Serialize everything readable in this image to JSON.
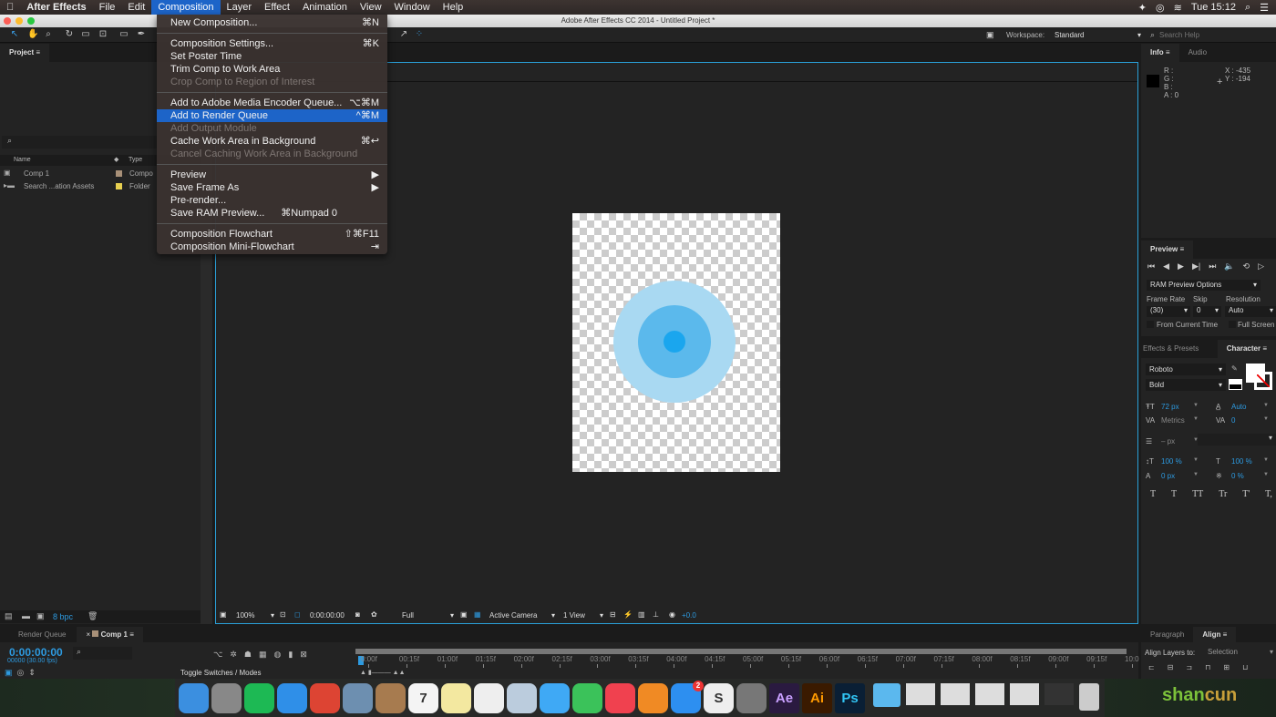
{
  "menubar": {
    "app": "After Effects",
    "items": [
      "File",
      "Edit",
      "Composition",
      "Layer",
      "Effect",
      "Animation",
      "View",
      "Window",
      "Help"
    ],
    "active": "Composition",
    "clock": "Tue 15:12"
  },
  "window_title": "Adobe After Effects CC 2014 - Untitled Project *",
  "toolbar": {
    "workspace_label": "Workspace:",
    "workspace_value": "Standard",
    "search_placeholder": "Search Help"
  },
  "composition_menu": [
    [
      {
        "label": "New Composition...",
        "shortcut": "⌘N"
      }
    ],
    [
      {
        "label": "Composition Settings...",
        "shortcut": "⌘K"
      },
      {
        "label": "Set Poster Time",
        "shortcut": ""
      },
      {
        "label": "Trim Comp to Work Area",
        "shortcut": ""
      },
      {
        "label": "Crop Comp to Region of Interest",
        "shortcut": "",
        "disabled": true
      }
    ],
    [
      {
        "label": "Add to Adobe Media Encoder Queue...",
        "shortcut": "⌥⌘M"
      },
      {
        "label": "Add to Render Queue",
        "shortcut": "^⌘M",
        "highlighted": true
      },
      {
        "label": "Add Output Module",
        "shortcut": "",
        "disabled": true
      },
      {
        "label": "Cache Work Area in Background",
        "shortcut": "⌘↩"
      },
      {
        "label": "Cancel Caching Work Area in Background",
        "shortcut": "",
        "disabled": true
      }
    ],
    [
      {
        "label": "Preview",
        "shortcut": "▶"
      },
      {
        "label": "Save Frame As",
        "shortcut": "▶"
      },
      {
        "label": "Pre-render...",
        "shortcut": ""
      },
      {
        "label": "Save RAM Preview...",
        "shortcut": "⌘Numpad 0"
      }
    ],
    [
      {
        "label": "Composition Flowchart",
        "shortcut": "⇧⌘F11"
      },
      {
        "label": "Composition Mini-Flowchart",
        "shortcut": "⇥"
      }
    ]
  ],
  "project": {
    "tab": "Project",
    "columns": [
      "Name",
      "Type"
    ],
    "items": [
      {
        "name": "Comp 1",
        "type": "Compo",
        "color": "#a89078"
      },
      {
        "name": "Search ...ation Assets",
        "type": "Folder",
        "color": "#e8d050"
      }
    ],
    "bpc": "8 bpc"
  },
  "viewer": {
    "zoom": "100%",
    "timecode": "0:00:00:00",
    "resolution": "Full",
    "camera": "Active Camera",
    "views": "1 View",
    "exposure": "+0.0",
    "circle_colors": [
      "#a9d9f2",
      "#5bb9ec",
      "#1aa6ee"
    ]
  },
  "info": {
    "tabs": [
      "Info",
      "Audio"
    ],
    "r": "R :",
    "g": "G :",
    "b": "B :",
    "a": "A : 0",
    "x": "X : -435",
    "y": "Y : -194"
  },
  "preview": {
    "tab": "Preview",
    "options": "RAM Preview Options",
    "frame_rate_label": "Frame Rate",
    "skip_label": "Skip",
    "resolution_label": "Resolution",
    "frame_rate": "(30)",
    "skip": "0",
    "resolution": "Auto",
    "from_current": "From Current Time",
    "full_screen": "Full Screen"
  },
  "character": {
    "tabs": [
      "Effects & Presets",
      "Character"
    ],
    "font": "Roboto",
    "style": "Bold",
    "size": "72 px",
    "leading": "Auto",
    "kerning": "Metrics",
    "tracking": "0",
    "stroke": "– px",
    "vscale": "100 %",
    "hscale": "100 %",
    "baseline": "0 px",
    "tsume": "0 %",
    "styles": [
      "T",
      "T",
      "TT",
      "Tr",
      "T'",
      "T,"
    ]
  },
  "timeline": {
    "tabs": [
      "Render Queue",
      "Comp 1"
    ],
    "timecode": "0:00:00:00",
    "frames": "00000 (30.00 fps)",
    "toggle": "Toggle Switches / Modes",
    "ruler": [
      "0:00f",
      "00:15f",
      "01:00f",
      "01:15f",
      "02:00f",
      "02:15f",
      "03:00f",
      "03:15f",
      "04:00f",
      "04:15f",
      "05:00f",
      "05:15f",
      "06:00f",
      "06:15f",
      "07:00f",
      "07:15f",
      "08:00f",
      "08:15f",
      "09:00f",
      "09:15f",
      "10:0"
    ]
  },
  "align": {
    "tabs": [
      "Paragraph",
      "Align"
    ],
    "label": "Align Layers to:",
    "value": "Selection"
  },
  "dock": [
    {
      "name": "finder",
      "c": "#3b8fe0",
      "t": ""
    },
    {
      "name": "launchpad",
      "c": "#888",
      "t": ""
    },
    {
      "name": "spotify",
      "c": "#1db954",
      "t": ""
    },
    {
      "name": "safari",
      "c": "#2f8fe8",
      "t": ""
    },
    {
      "name": "chrome",
      "c": "#dd4433",
      "t": ""
    },
    {
      "name": "mail",
      "c": "#6d8fb0",
      "t": ""
    },
    {
      "name": "contacts",
      "c": "#a77b4f",
      "t": ""
    },
    {
      "name": "calendar",
      "c": "#f4f4f4",
      "t": "7"
    },
    {
      "name": "notes",
      "c": "#f3e8a0",
      "t": ""
    },
    {
      "name": "reminders",
      "c": "#eee",
      "t": ""
    },
    {
      "name": "preview",
      "c": "#bcd",
      "t": ""
    },
    {
      "name": "messages",
      "c": "#3fa9f5",
      "t": ""
    },
    {
      "name": "facetime",
      "c": "#3bc25a",
      "t": ""
    },
    {
      "name": "itunes",
      "c": "#f0414f",
      "t": ""
    },
    {
      "name": "ibooks",
      "c": "#f08a24",
      "t": ""
    },
    {
      "name": "app-store",
      "c": "#2d8ff0",
      "t": "",
      "badge": "2"
    },
    {
      "name": "slack",
      "c": "#eee",
      "t": "S"
    },
    {
      "name": "system-preferences",
      "c": "#777",
      "t": ""
    },
    {
      "name": "after-effects",
      "c": "#2a1a40",
      "t": "Ae"
    },
    {
      "name": "illustrator",
      "c": "#3a1a00",
      "t": "Ai"
    },
    {
      "name": "photoshop",
      "c": "#0a1f35",
      "t": "Ps"
    }
  ],
  "watermark": "shancun"
}
